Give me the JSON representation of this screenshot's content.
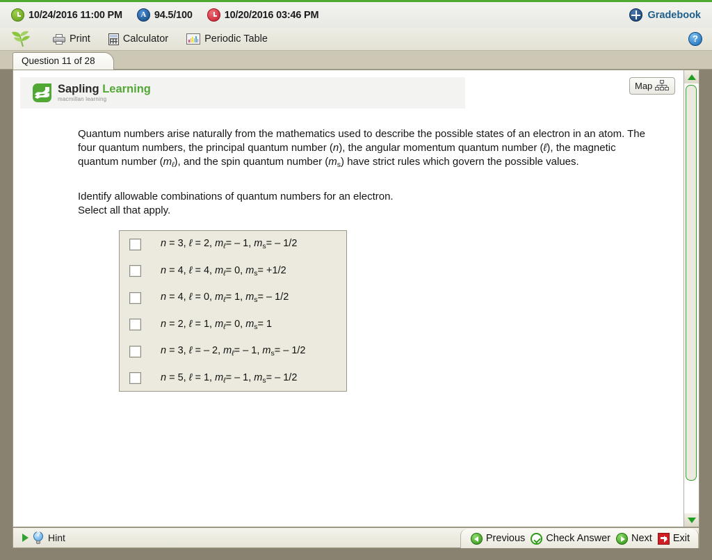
{
  "topbar": {
    "due_icon": "alarm-clock-icon",
    "due_date": "10/24/2016 11:00 PM",
    "grade_icon": "grade-badge-icon",
    "grade_badge_text": "A",
    "grade": "94.5/100",
    "last_icon": "clock-red-icon",
    "last_date": "10/20/2016 03:46 PM",
    "gradebook_icon": "gradebook-icon",
    "gradebook_label": "Gradebook",
    "accent_green": "#4fa832",
    "link_blue": "#1c5f8c"
  },
  "toolbar": {
    "logo_name": "sapling-leaf-logo",
    "print_label": "Print",
    "calculator_label": "Calculator",
    "periodic_table_label": "Periodic Table",
    "help_label": "?"
  },
  "tab": {
    "label": "Question 11 of 28"
  },
  "brand": {
    "name_dark": "Sapling",
    "name_green": "Learning",
    "tagline": "macmillan learning",
    "green": "#52a835"
  },
  "map_button": {
    "label": "Map",
    "icon": "site-map-icon"
  },
  "question": {
    "paragraph_parts": [
      "Quantum numbers arise naturally from the mathematics used to describe the possible states of an electron in an atom. The four quantum numbers, the principal quantum number (",
      "n",
      "), the angular momentum quantum number (",
      "ℓ",
      "), the magnetic quantum number (",
      "m",
      "ℓ",
      "), and the spin quantum number (",
      "m",
      "s",
      ") have strict rules which govern the possible values."
    ],
    "prompt_line1": "Identify allowable combinations of quantum numbers for an electron.",
    "prompt_line2": "Select all that apply."
  },
  "options": [
    {
      "n": "3",
      "l": "2",
      "ml": "– 1",
      "ms": "– 1/2",
      "checked": false
    },
    {
      "n": "4",
      "l": "4",
      "ml": "0",
      "ms": "+1/2",
      "checked": false
    },
    {
      "n": "4",
      "l": "0",
      "ml": "1",
      "ms": "– 1/2",
      "checked": false
    },
    {
      "n": "2",
      "l": "1",
      "ml": "0",
      "ms": "1",
      "checked": false
    },
    {
      "n": "3",
      "l": "– 2",
      "ml": "– 1",
      "ms": "– 1/2",
      "checked": false
    },
    {
      "n": "5",
      "l": "1",
      "ml": "– 1",
      "ms": "– 1/2",
      "checked": false
    }
  ],
  "option_symbols": {
    "n": "n",
    "l": "ℓ",
    "ml_base": "m",
    "ml_sub": "ℓ",
    "ms_base": "m",
    "ms_sub": "s",
    "eq": "=",
    "comma": ","
  },
  "bottombar": {
    "hint_label": "Hint",
    "previous_label": "Previous",
    "check_answer_label": "Check Answer",
    "next_label": "Next",
    "exit_label": "Exit"
  },
  "scrollbar": {
    "up_arrow": "scroll-up-arrow",
    "down_arrow": "scroll-down-arrow",
    "thumb": "scroll-thumb"
  }
}
